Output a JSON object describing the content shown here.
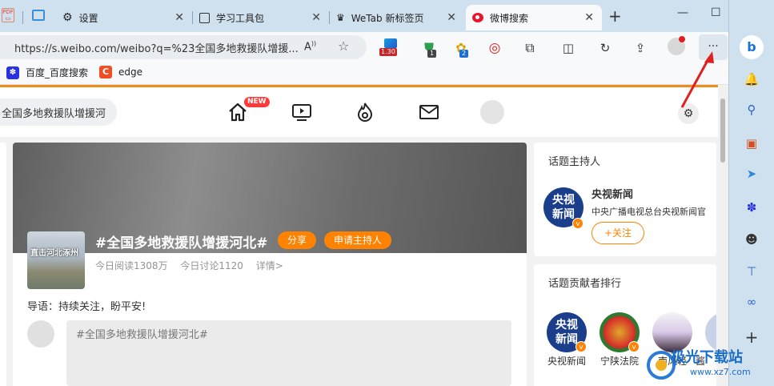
{
  "tabs": [
    {
      "title": "设置",
      "icon": "gear-icon"
    },
    {
      "title": "学习工具包",
      "icon": "page-icon"
    },
    {
      "title": "WeTab 新标签页",
      "icon": "crown-icon"
    },
    {
      "title": "微博搜索",
      "icon": "weibo-icon"
    }
  ],
  "address": {
    "url": "https://s.weibo.com/weibo?q=%23全国多地救援队增援..."
  },
  "toolbar": {
    "badge1": "1.30",
    "badge2": "1",
    "badge3": "2",
    "more_label": "···"
  },
  "favorites": [
    {
      "label": "百度_百度搜索"
    },
    {
      "label": "edge"
    }
  ],
  "weibo": {
    "search_text": "全国多地救援队增援河",
    "new_badge": "NEW",
    "topic_title": "#全国多地救援队增援河北#",
    "share_label": "分享",
    "apply_host_label": "申请主持人",
    "stats": {
      "reads": "今日阅读1308万",
      "discuss": "今日讨论1120",
      "details": "详情>"
    },
    "thumb_caption": "直击河北涿州",
    "lead_text": "导语：持续关注，盼平安!",
    "comment_placeholder": "#全国多地救援队增援河北#",
    "host_section_title": "话题主持人",
    "host_name": "央视新闻",
    "host_desc": "中央广播电视总台央视新闻官",
    "follow_label": "+关注",
    "rank_section_title": "话题贡献者排行",
    "ranks": [
      {
        "name": "央视新闻"
      },
      {
        "name": "宁陕法院"
      },
      {
        "name": "南风轻"
      },
      {
        "name": "酱"
      }
    ],
    "cctv_logo_line1": "央视",
    "cctv_logo_line2": "新闻"
  },
  "watermark": {
    "text": "极光下载站",
    "url": "www.xz7.com"
  },
  "colors": {
    "accent": "#ff8200",
    "tabbar": "#cfe0ee",
    "arrow": "#e02020"
  }
}
